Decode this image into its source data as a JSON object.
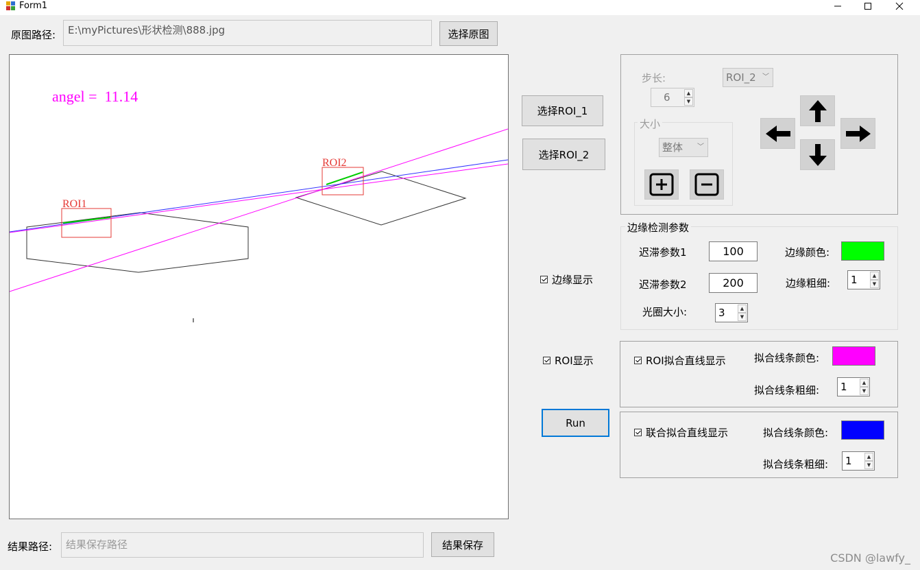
{
  "window": {
    "title": "Form1"
  },
  "source": {
    "label": "原图路径:",
    "path": "E:\\myPictures\\形状检测\\888.jpg",
    "button": "选择原图"
  },
  "result": {
    "label": "结果路径:",
    "placeholder": "结果保存路径",
    "button": "结果保存"
  },
  "image": {
    "angle_text": "angel =  11.14",
    "roi1_label": "ROI1",
    "roi2_label": "ROI2",
    "colors": {
      "roi_box": "#e53935",
      "fit_line": "#ff00ff",
      "joint_line": "#3333ff",
      "edge": "#00cc00",
      "shape": "#333333"
    }
  },
  "roi_buttons": {
    "roi1": "选择ROI_1",
    "roi2": "选择ROI_2"
  },
  "move_panel": {
    "step_label": "步长:",
    "step_value": "6",
    "roi_select": "ROI_2",
    "size_group": "大小",
    "size_select": "整体",
    "icons": {
      "plus": "plus-square-icon",
      "minus": "minus-square-icon",
      "up": "arrow-up-icon",
      "down": "arrow-down-icon",
      "left": "arrow-left-icon",
      "right": "arrow-right-icon"
    }
  },
  "edge_params": {
    "title": "边缘检测参数",
    "hyst1_label": "迟滞参数1",
    "hyst1_value": "100",
    "hyst2_label": "迟滞参数2",
    "hyst2_value": "200",
    "aperture_label": "光圈大小:",
    "aperture_value": "3",
    "color_label": "边缘颜色:",
    "color": "#00ff00",
    "thickness_label": "边缘粗细:",
    "thickness_value": "1"
  },
  "checks": {
    "edge_show": "边缘显示",
    "roi_show": "ROI显示"
  },
  "run_button": "Run",
  "roi_fit": {
    "check": "ROI拟合直线显示",
    "color_label": "拟合线条颜色:",
    "color": "#ff00ff",
    "thickness_label": "拟合线条粗细:",
    "thickness_value": "1"
  },
  "joint_fit": {
    "check": "联合拟合直线显示",
    "color_label": "拟合线条颜色:",
    "color": "#0000ff",
    "thickness_label": "拟合线条粗细:",
    "thickness_value": "1"
  },
  "watermark": "CSDN @lawfy_"
}
